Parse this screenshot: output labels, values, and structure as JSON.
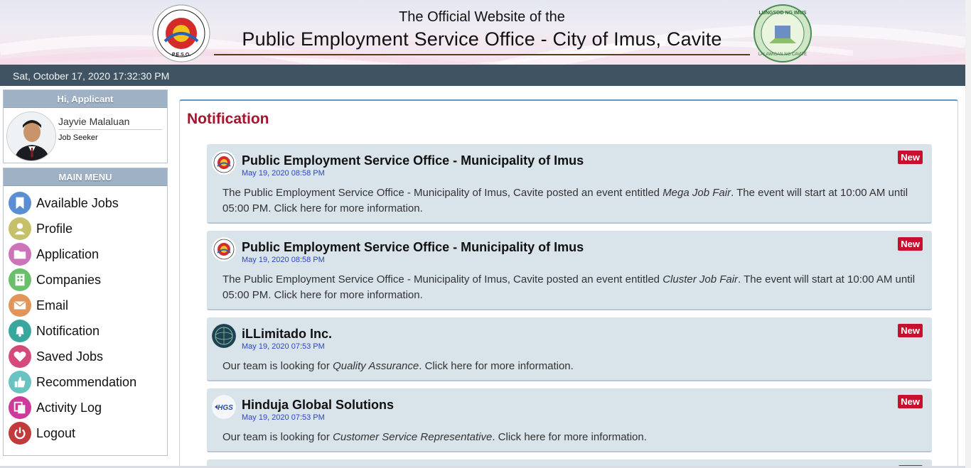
{
  "header": {
    "subtitle": "The Official Website of the",
    "title": "Public Employment Service Office - City of Imus, Cavite",
    "left_logo_icon": "peso-seal-logo",
    "right_logo_icon": "lungsod-ng-imus-seal-logo"
  },
  "datetime": "Sat, October 17, 2020 17:32:30 PM",
  "user": {
    "greeting": "Hi, Applicant",
    "name": "Jayvie Malaluan",
    "role": "Job Seeker"
  },
  "menu": {
    "heading": "MAIN MENU",
    "items": [
      {
        "label": "Available Jobs",
        "icon": "bookmark-icon",
        "color": "#5b8fd1"
      },
      {
        "label": "Profile",
        "icon": "user-icon",
        "color": "#c7c06a"
      },
      {
        "label": "Application",
        "icon": "folder-icon",
        "color": "#cc73b9"
      },
      {
        "label": "Companies",
        "icon": "building-icon",
        "color": "#6abf6a"
      },
      {
        "label": "Email",
        "icon": "envelope-icon",
        "color": "#e2955a"
      },
      {
        "label": "Notification",
        "icon": "bell-icon",
        "color": "#3aa79c"
      },
      {
        "label": "Saved Jobs",
        "icon": "heart-icon",
        "color": "#d44a7a"
      },
      {
        "label": "Recommendation",
        "icon": "thumbs-up-icon",
        "color": "#69c3c3"
      },
      {
        "label": "Activity Log",
        "icon": "copy-icon",
        "color": "#cd3a9a"
      },
      {
        "label": "Logout",
        "icon": "power-icon",
        "color": "#c23b3b"
      }
    ]
  },
  "main": {
    "title": "Notification",
    "badge_label": "New",
    "notifications": [
      {
        "name": "Public Employment Service Office - Municipality of Imus",
        "date": "May 19, 2020 08:58 PM",
        "text_before": "The Public Employment Service Office - Municipality of Imus, Cavite posted an event entitled ",
        "text_em": "Mega Job Fair",
        "text_after": ". The event will start at 10:00 AM until 05:00 PM. Click here for more information.",
        "logo": "peso-logo"
      },
      {
        "name": "Public Employment Service Office - Municipality of Imus",
        "date": "May 19, 2020 08:58 PM",
        "text_before": "The Public Employment Service Office - Municipality of Imus, Cavite posted an event entitled ",
        "text_em": "Cluster Job Fair",
        "text_after": ". The event will start at 10:00 AM until 05:00 PM. Click here for more information.",
        "logo": "peso-logo"
      },
      {
        "name": "iLLimitado Inc.",
        "date": "May 19, 2020 07:53 PM",
        "text_before": "Our team is looking for ",
        "text_em": "Quality Assurance",
        "text_after": ". Click here for more information.",
        "logo": "illimitado-logo"
      },
      {
        "name": "Hinduja Global Solutions",
        "date": "May 19, 2020 07:53 PM",
        "text_before": "Our team is looking for ",
        "text_em": "Customer Service Representative",
        "text_after": ". Click here for more information.",
        "logo": "hgs-logo",
        "logo_text": "HGS"
      }
    ]
  }
}
